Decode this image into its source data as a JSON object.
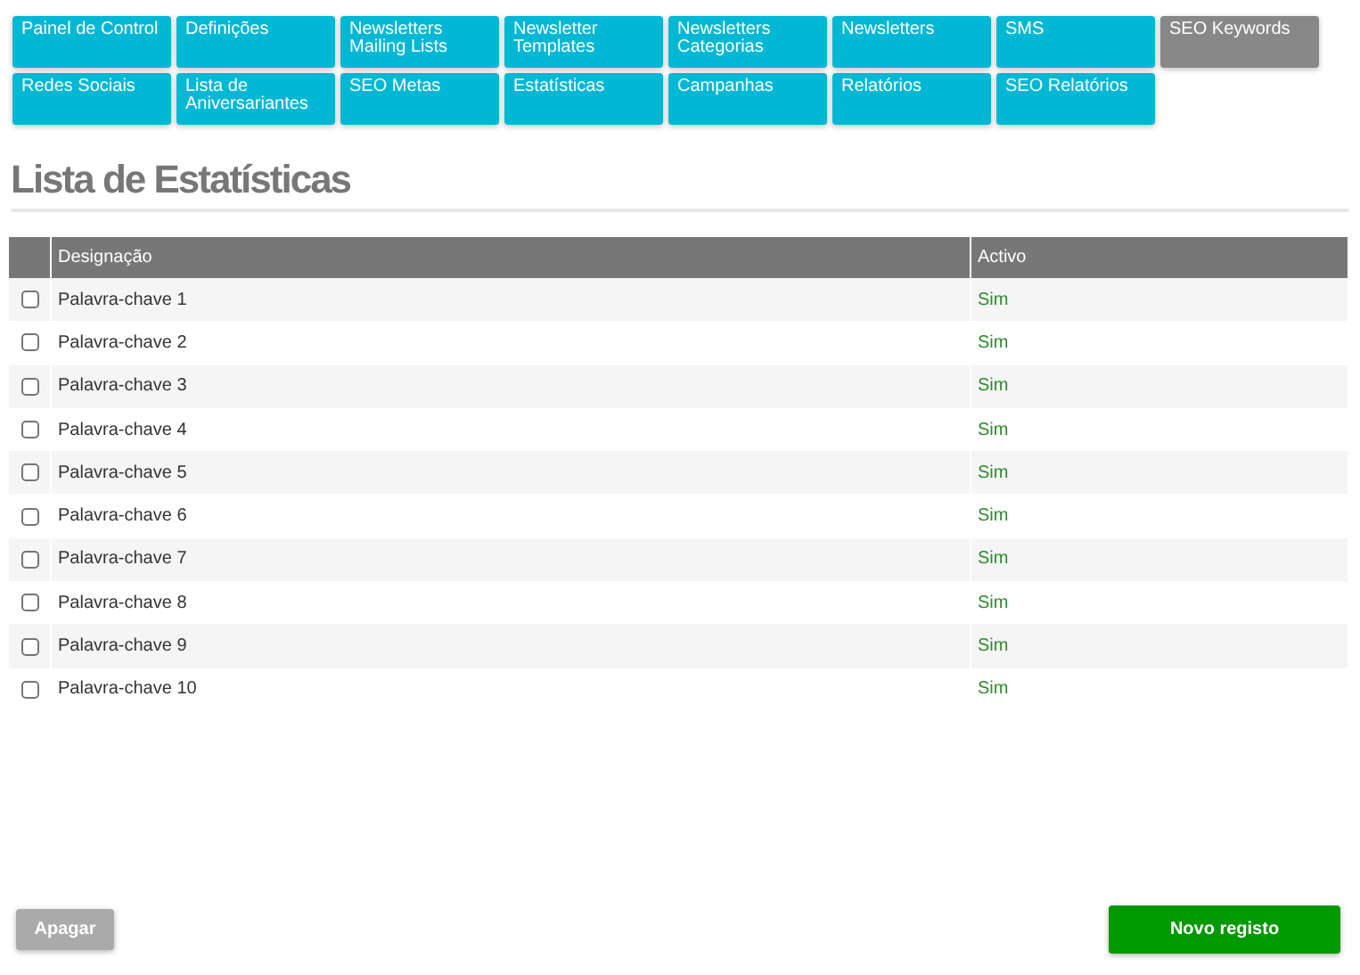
{
  "menu": [
    {
      "label": "Painel de Control",
      "selected": false
    },
    {
      "label": "Definições",
      "selected": false
    },
    {
      "label": "Newsletters Mailing Lists",
      "selected": false
    },
    {
      "label": "Newsletter Templates",
      "selected": false
    },
    {
      "label": "Newsletters Categorias",
      "selected": false
    },
    {
      "label": "Newsletters",
      "selected": false
    },
    {
      "label": "SMS",
      "selected": false
    },
    {
      "label": "SEO Keywords",
      "selected": true
    },
    {
      "label": "Redes Sociais",
      "selected": false
    },
    {
      "label": "Lista de Aniversariantes",
      "selected": false
    },
    {
      "label": "SEO Metas",
      "selected": false
    },
    {
      "label": "Estatísticas",
      "selected": false
    },
    {
      "label": "Campanhas",
      "selected": false
    },
    {
      "label": "Relatórios",
      "selected": false
    },
    {
      "label": "SEO Relatórios",
      "selected": false
    }
  ],
  "title": "Lista de Estatísticas",
  "table": {
    "columns": [
      "Designação",
      "Activo"
    ],
    "rows": [
      {
        "checked": false,
        "cells": [
          "Palavra-chave 1",
          "Sim"
        ]
      },
      {
        "checked": false,
        "cells": [
          "Palavra-chave 2",
          "Sim"
        ]
      },
      {
        "checked": false,
        "cells": [
          "Palavra-chave 3",
          "Sim"
        ]
      },
      {
        "checked": false,
        "cells": [
          "Palavra-chave 4",
          "Sim"
        ]
      },
      {
        "checked": false,
        "cells": [
          "Palavra-chave 5",
          "Sim"
        ]
      },
      {
        "checked": false,
        "cells": [
          "Palavra-chave 6",
          "Sim"
        ]
      },
      {
        "checked": false,
        "cells": [
          "Palavra-chave 7",
          "Sim"
        ]
      },
      {
        "checked": false,
        "cells": [
          "Palavra-chave 8",
          "Sim"
        ]
      },
      {
        "checked": false,
        "cells": [
          "Palavra-chave 9",
          "Sim"
        ]
      },
      {
        "checked": false,
        "cells": [
          "Palavra-chave 10",
          "Sim"
        ]
      }
    ]
  },
  "buttons": {
    "delete": "Apagar",
    "new": "Novo registo"
  }
}
